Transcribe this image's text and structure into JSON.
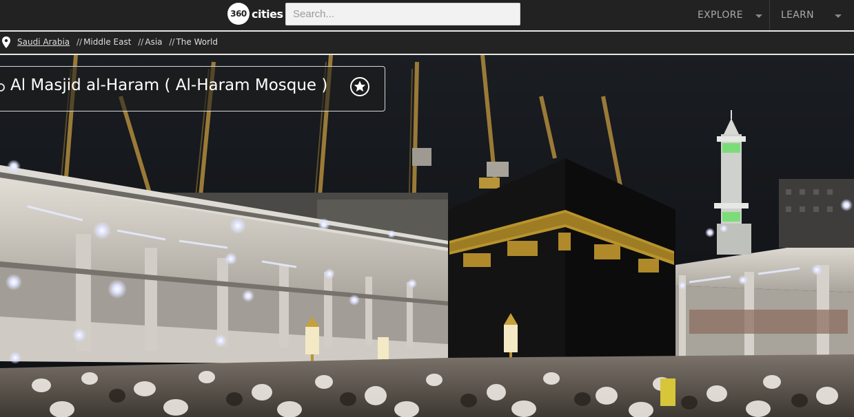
{
  "logo": {
    "number": "360",
    "word": "cities"
  },
  "search": {
    "placeholder": "Search..."
  },
  "nav": {
    "explore_label": "EXPLORE",
    "learn_label": "LEARN"
  },
  "breadcrumb": {
    "country": "Saudi Arabia",
    "separator": "//",
    "region": "Middle East",
    "continent": "Asia",
    "world": "The World"
  },
  "panorama": {
    "title": "Al Masjid al-Haram ( Al-Haram Mosque )"
  },
  "icons": {
    "location": "map-pin-icon",
    "favorite": "star-circle-icon",
    "dropdown": "caret-down-icon"
  },
  "colors": {
    "topbar": "#222222",
    "breadcrumb_bar": "#232323",
    "night_sky": "#111417",
    "kaaba": "#141414",
    "gold": "#b8942e"
  }
}
